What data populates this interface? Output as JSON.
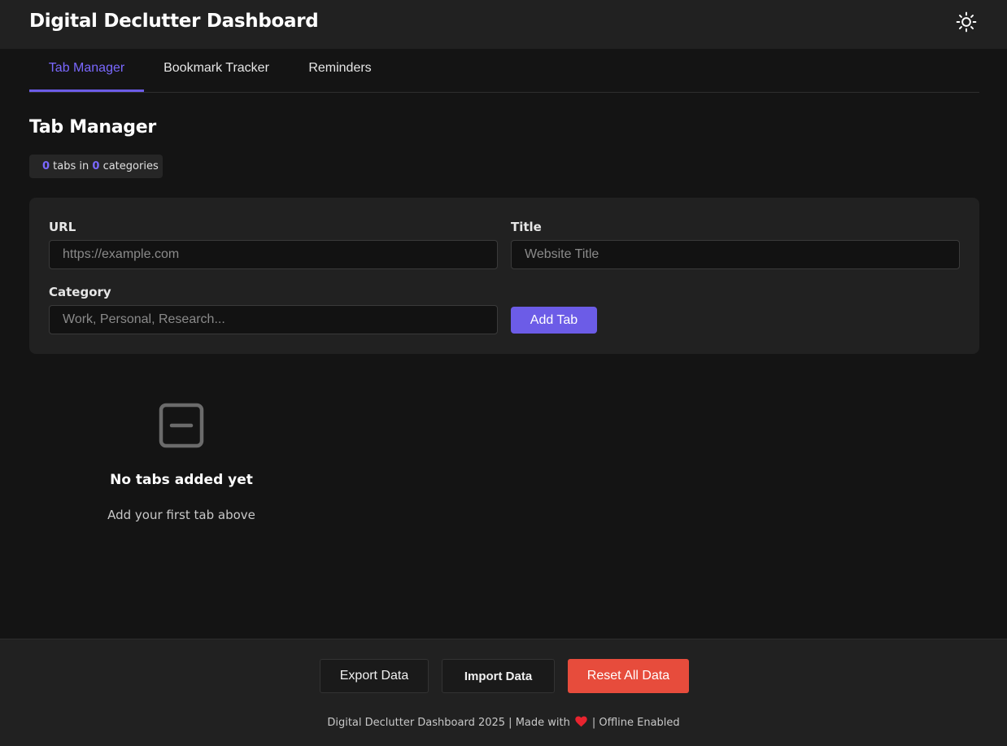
{
  "app": {
    "title": "Digital Declutter Dashboard",
    "theme_toggle_icon": "sun-icon"
  },
  "tabs": [
    {
      "label": "Tab Manager",
      "active": true
    },
    {
      "label": "Bookmark Tracker",
      "active": false
    },
    {
      "label": "Reminders",
      "active": false
    }
  ],
  "section": {
    "title": "Tab Manager",
    "stats": {
      "tab_count": "0",
      "tabs_text": " tabs in ",
      "category_count": "0",
      "categories_text": " categories"
    }
  },
  "form": {
    "url_label": "URL",
    "url_placeholder": "https://example.com",
    "url_value": "",
    "title_label": "Title",
    "title_placeholder": "Website Title",
    "title_value": "",
    "category_label": "Category",
    "category_placeholder": "Work, Personal, Research...",
    "category_value": "",
    "add_button": "Add Tab"
  },
  "empty_state": {
    "icon": "minus-square-icon",
    "title": "No tabs added yet",
    "subtitle": "Add your first tab above"
  },
  "footer": {
    "export_button": "Export Data",
    "import_button": "Import Data",
    "reset_button": "Reset All Data",
    "note_before": "Digital Declutter Dashboard 2025 | Made with",
    "note_icon": "heart-icon",
    "note_after": "| Offline Enabled"
  },
  "colors": {
    "accent": "#6c5ce7",
    "danger": "#e74c3c",
    "background": "#141414",
    "surface": "#212121"
  }
}
